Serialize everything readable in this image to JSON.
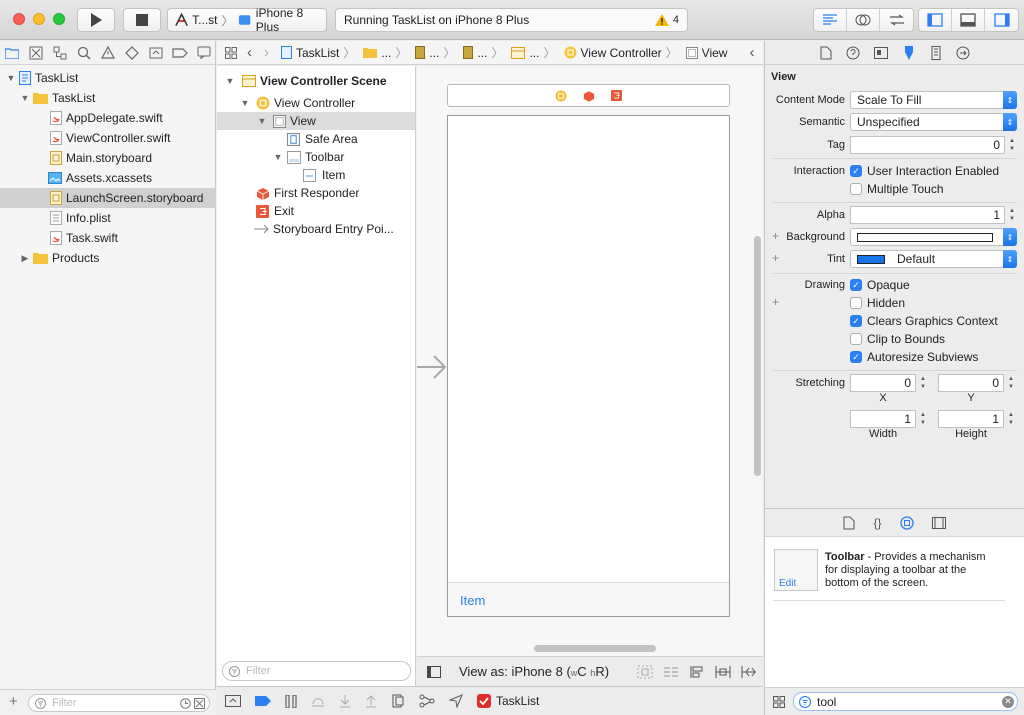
{
  "toolbar": {
    "scheme_target": "T...st",
    "device": "iPhone 8 Plus",
    "status_text": "Running TaskList on iPhone 8 Plus",
    "warning_count": "4"
  },
  "navigator": {
    "items": [
      {
        "label": "TaskList",
        "level": 0,
        "kind": "project"
      },
      {
        "label": "TaskList",
        "level": 1,
        "kind": "folder"
      },
      {
        "label": "AppDelegate.swift",
        "level": 2,
        "kind": "swift"
      },
      {
        "label": "ViewController.swift",
        "level": 2,
        "kind": "swift"
      },
      {
        "label": "Main.storyboard",
        "level": 2,
        "kind": "storyboard"
      },
      {
        "label": "Assets.xcassets",
        "level": 2,
        "kind": "assets"
      },
      {
        "label": "LaunchScreen.storyboard",
        "level": 2,
        "kind": "storyboard"
      },
      {
        "label": "Info.plist",
        "level": 2,
        "kind": "plist"
      },
      {
        "label": "Task.swift",
        "level": 2,
        "kind": "swift"
      },
      {
        "label": "Products",
        "level": 1,
        "kind": "folder"
      }
    ],
    "filter_placeholder": "Filter"
  },
  "jumpbar": {
    "crumbs": [
      "TaskList",
      "...",
      "...",
      "...",
      "...",
      "View Controller",
      "View"
    ]
  },
  "outline": {
    "items": [
      {
        "label": "View Controller Scene",
        "bold": true
      },
      {
        "label": "View Controller"
      },
      {
        "label": "View"
      },
      {
        "label": "Safe Area"
      },
      {
        "label": "Toolbar"
      },
      {
        "label": "Item"
      },
      {
        "label": "First Responder"
      },
      {
        "label": "Exit"
      },
      {
        "label": "Storyboard Entry Poi..."
      }
    ],
    "filter_placeholder": "Filter"
  },
  "canvas": {
    "toolbar_item_label": "Item",
    "view_as_prefix": "View as: iPhone 8 (",
    "view_as_w": "w",
    "view_as_c": "C",
    "view_as_h": "h",
    "view_as_r": "R)"
  },
  "debugbar": {
    "target": "TaskList"
  },
  "inspector": {
    "section_title": "View",
    "content_mode_label": "Content Mode",
    "content_mode_value": "Scale To Fill",
    "semantic_label": "Semantic",
    "semantic_value": "Unspecified",
    "tag_label": "Tag",
    "tag_value": "0",
    "interaction_label": "Interaction",
    "user_interaction": "User Interaction Enabled",
    "multiple_touch": "Multiple Touch",
    "alpha_label": "Alpha",
    "alpha_value": "1",
    "background_label": "Background",
    "tint_label": "Tint",
    "tint_value": "Default",
    "drawing_label": "Drawing",
    "opaque": "Opaque",
    "hidden": "Hidden",
    "clears_graphics": "Clears Graphics Context",
    "clip_bounds": "Clip to Bounds",
    "autoresize": "Autoresize Subviews",
    "stretching_label": "Stretching",
    "stretch_x": "0",
    "stretch_y": "0",
    "x_label": "X",
    "y_label": "Y",
    "stretch_w": "1",
    "stretch_h": "1",
    "width_label": "Width",
    "height_label": "Height"
  },
  "library": {
    "item_title": "Toolbar",
    "item_desc": " - Provides a mechanism for displaying a toolbar at the bottom of the screen.",
    "edit_label": "Edit",
    "search_value": "tool"
  },
  "colors": {
    "accent": "#2c7ff0",
    "warning": "#f5b800",
    "tint_swatch": "#1a74e8"
  }
}
